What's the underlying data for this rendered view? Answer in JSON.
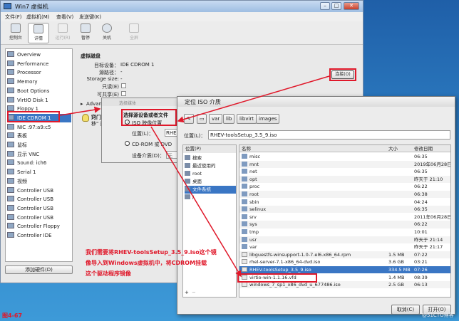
{
  "vm_window": {
    "title": "Win7 虚拟机",
    "menu": [
      "文件(F)",
      "虚拟机(M)",
      "查看(V)",
      "发送键(K)"
    ],
    "toolbar": [
      {
        "label": "控制台",
        "icon": "monitor-icon"
      },
      {
        "label": "详情",
        "icon": "info-icon"
      },
      {
        "label": "运行(R)",
        "icon": "play-icon"
      },
      {
        "label": "暂停",
        "icon": "pause-icon"
      },
      {
        "label": "关机",
        "icon": "power-icon"
      },
      {
        "label": "全屏",
        "icon": "fullscreen-icon"
      }
    ],
    "hardware": [
      "Overview",
      "Performance",
      "Processor",
      "Memory",
      "Boot Options",
      "VirtIO Disk 1",
      "Floppy 1",
      "IDE CDROM 1",
      "NIC :97:a9:c5",
      "表板",
      "鼠标",
      "显示 VNC",
      "Sound: ich6",
      "Serial 1",
      "视频",
      "Controller USB",
      "Controller USB",
      "Controller USB",
      "Controller USB",
      "Controller Floppy",
      "Controller IDE"
    ],
    "add_hardware": "添加硬件(D)",
    "detail": {
      "section": "虚拟磁盘",
      "target_label": "目标设备：",
      "target_value": "IDE CDROM 1",
      "source_label": "源路径：",
      "source_value": "-",
      "storage_label": "Storage size:",
      "storage_value": "-",
      "readonly_label": "只读(E)",
      "shareable_label": "可共享(E)",
      "advanced_label": "Advanced",
      "tip_label": "窍门：",
      "tip_text": "\"...",
      "tip_text2": "移\" 指从...",
      "browse_button": "连接(O)"
    }
  },
  "media_dialog": {
    "title": "选择媒体",
    "heading": "选择源设备或者文件",
    "iso_option": "ISO 映像位置",
    "location_label": "位置(L)：",
    "location_value": "RHE",
    "cdrom_option": "CD-ROM 或 DVD",
    "device_label": "设备介质(D)：",
    "device_value": "无"
  },
  "iso_dialog": {
    "title": "定位 ISO 介质",
    "path": [
      "var",
      "lib",
      "libvirt",
      "images"
    ],
    "location_label": "位置(L)：",
    "location_value": "RHEV-toolsSetup_3.5_9.iso",
    "places_header": "位置(P)",
    "places": [
      "搜索",
      "最近使用的",
      "root",
      "桌面",
      "文件系统",
      "/"
    ],
    "columns": {
      "name": "名称",
      "size": "大小",
      "modified": "修改日期"
    },
    "files": [
      {
        "name": "misc",
        "size": "",
        "modified": "06:35",
        "folder": true
      },
      {
        "name": "mnt",
        "size": "",
        "modified": "2019年06月28日",
        "folder": true
      },
      {
        "name": "net",
        "size": "",
        "modified": "06:35",
        "folder": true
      },
      {
        "name": "opt",
        "size": "",
        "modified": "昨天于 21:10",
        "folder": true
      },
      {
        "name": "proc",
        "size": "",
        "modified": "06:22",
        "folder": true
      },
      {
        "name": "root",
        "size": "",
        "modified": "06:38",
        "folder": true
      },
      {
        "name": "sbin",
        "size": "",
        "modified": "04:24",
        "folder": true
      },
      {
        "name": "selinux",
        "size": "",
        "modified": "06:35",
        "folder": true
      },
      {
        "name": "srv",
        "size": "",
        "modified": "2011年06月28日",
        "folder": true
      },
      {
        "name": "sys",
        "size": "",
        "modified": "06:22",
        "folder": true
      },
      {
        "name": "tmp",
        "size": "",
        "modified": "10:01",
        "folder": true
      },
      {
        "name": "usr",
        "size": "",
        "modified": "昨天于 21:14",
        "folder": true
      },
      {
        "name": "var",
        "size": "",
        "modified": "昨天于 21:17",
        "folder": true
      },
      {
        "name": "libguestfs-winsupport-1.0-7.el6.x86_64.rpm",
        "size": "1.5 MB",
        "modified": "07:22",
        "folder": false
      },
      {
        "name": "rhel-server-7.1-x86_64-dvd.iso",
        "size": "3.6 GB",
        "modified": "03:21",
        "folder": false
      },
      {
        "name": "RHEV-toolsSetup_3.5_9.iso",
        "size": "334.5 MB",
        "modified": "07:26",
        "folder": false,
        "selected": true
      },
      {
        "name": "virtio-win-1.1.16.vfd",
        "size": "1.4 MB",
        "modified": "08:39",
        "folder": false
      },
      {
        "name": "windows_7_sp1_x86_dvd_u_677486.iso",
        "size": "2.5 GB",
        "modified": "06:13",
        "folder": false
      }
    ],
    "cancel_button": "取消(C)",
    "open_button": "打开(O)"
  },
  "annotation": [
    "我们需要将RHEV-toolsSetup_3.5_9.iso这个镜",
    "像导入到Windows虚拟机中，将CDROM挂载",
    "这个驱动程序镜像"
  ],
  "figure_label": "图4-67",
  "watermark": "@51CTO博客",
  "colors": {
    "highlight": "#e0182a",
    "selection": "#3a76c4"
  }
}
